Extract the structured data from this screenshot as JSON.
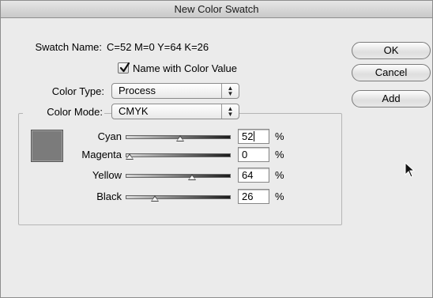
{
  "window": {
    "title": "New Color Swatch"
  },
  "swatch_name": {
    "label": "Swatch Name:",
    "value": "C=52 M=0 Y=64 K=26"
  },
  "name_with_color_value": {
    "label": "Name with Color Value",
    "checked": true
  },
  "color_type": {
    "label": "Color Type:",
    "selected": "Process"
  },
  "color_mode": {
    "label": "Color Mode:",
    "selected": "CMYK"
  },
  "buttons": {
    "ok": "OK",
    "cancel": "Cancel",
    "add": "Add"
  },
  "preview_color": "#7b7b7b",
  "channels": [
    {
      "label": "Cyan",
      "value": "52",
      "unit": "%",
      "fraction": 0.52
    },
    {
      "label": "Magenta",
      "value": "0",
      "unit": "%",
      "fraction": 0.0
    },
    {
      "label": "Yellow",
      "value": "64",
      "unit": "%",
      "fraction": 0.64
    },
    {
      "label": "Black",
      "value": "26",
      "unit": "%",
      "fraction": 0.26
    }
  ]
}
